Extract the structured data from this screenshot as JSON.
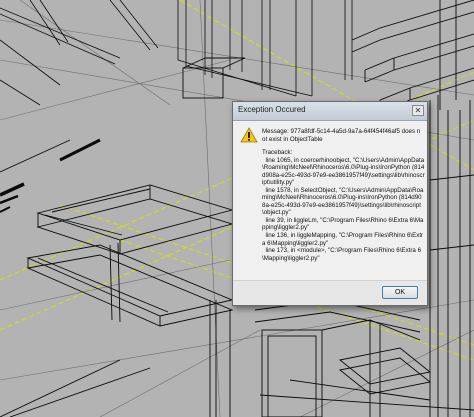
{
  "dialog": {
    "title": "Exception Occured",
    "close_label": "✕",
    "message": "Message: 977a8fdf-5c14-4a5d-9a7a-64f454f46af5 does not exist in ObjectTable",
    "traceback": "Traceback:\n  line 1065, in coercerhinoobject, \"C:\\Users\\Admin\\AppData\\Roaming\\McNeel\\Rhinoceros\\6.0\\Plug-ins\\IronPython (814d908a-e25c-493d-97e9-ee3861957f49)\\settings\\lib\\rhinoscript\\utility.py\"\n  line 1578, in SelectObject, \"C:\\Users\\Admin\\AppData\\Roaming\\McNeel\\Rhinoceros\\6.0\\Plug-ins\\IronPython (814d908a-e25c-493d-97e9-ee3861957f49)\\settings\\lib\\rhinoscript\\object.py\"\n  line 39, in liggleLm, \"C:\\Program Files\\Rhino 6\\Extra 6\\Mapping\\liggler2.py\"\n  line 136, in liggleMapping, \"C:\\Program Files\\Rhino 6\\Extra 6\\Mapping\\liggler2.py\"\n  line 173, in <module>, \"C:\\Program Files\\Rhino 6\\Extra 6\\Mapping\\liggler2.py\"",
    "ok_label": "OK",
    "icon": "warning-icon"
  },
  "viewport": {
    "background": "#b3b3b3",
    "wire_color": "#0a0a0a",
    "grid_color": "#d8e000"
  }
}
